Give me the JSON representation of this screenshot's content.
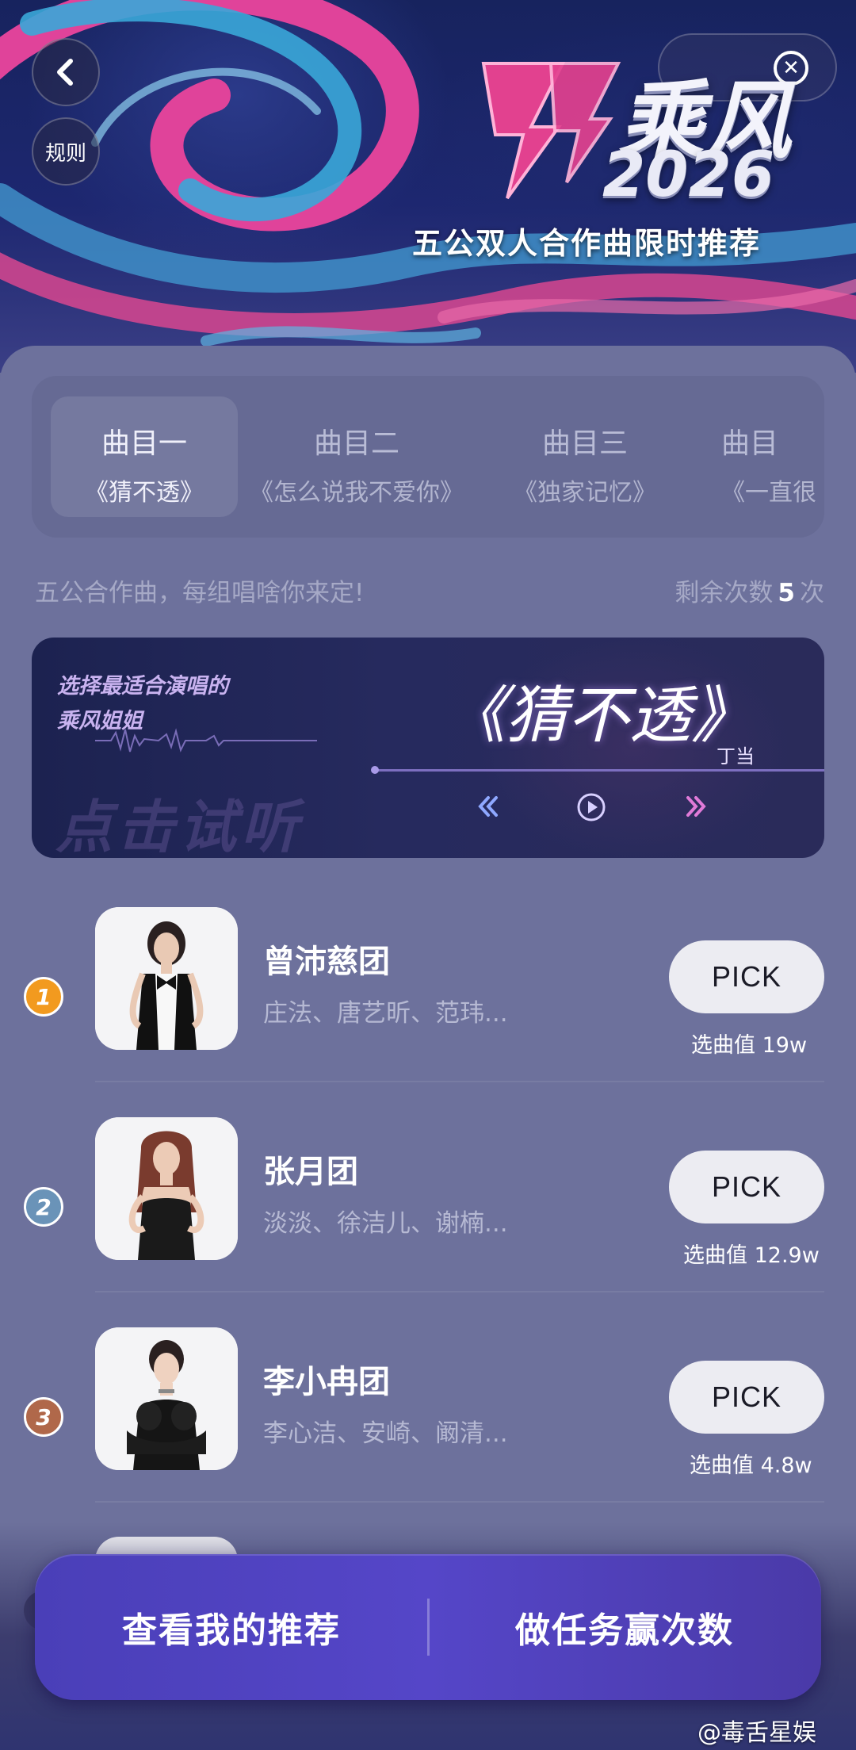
{
  "header": {
    "rules_label": "规则",
    "title": "乘风",
    "year": "2026",
    "subtitle": "五公双人合作曲限时推荐"
  },
  "tabs": [
    {
      "name": "曲目一",
      "song": "《猜不透》",
      "active": true
    },
    {
      "name": "曲目二",
      "song": "《怎么说我不爱你》",
      "active": false
    },
    {
      "name": "曲目三",
      "song": "《独家记忆》",
      "active": false
    },
    {
      "name": "曲目",
      "song": "《一直很",
      "active": false
    }
  ],
  "info": {
    "tagline": "五公合作曲，每组唱啥你来定!",
    "remaining_label": "剩余次数",
    "remaining_count": "5",
    "remaining_unit": "次"
  },
  "banner": {
    "hint_line1": "选择最适合演唱的",
    "hint_line2": "乘风姐姐",
    "song": "《猜不透》",
    "singer": "丁当",
    "bg_text": "点击试听"
  },
  "teams": [
    {
      "rank": "1",
      "name": "曾沛慈团",
      "members": "庄法、唐艺昕、范玮...",
      "pick_label": "PICK",
      "value_label": "选曲值",
      "value": "19w",
      "rank_color": "#f29a1f"
    },
    {
      "rank": "2",
      "name": "张月团",
      "members": "淡淡、徐洁儿、谢楠...",
      "pick_label": "PICK",
      "value_label": "选曲值",
      "value": "12.9w",
      "rank_color": "#6a93b8"
    },
    {
      "rank": "3",
      "name": "李小冉团",
      "members": "李心洁、安崎、阚清...",
      "pick_label": "PICK",
      "value_label": "选曲值",
      "value": "4.8w",
      "rank_color": "#b0684a"
    }
  ],
  "bottom_bar": {
    "left_label": "查看我的推荐",
    "right_label": "做任务赢次数"
  },
  "watermark": "@毒舌星娱"
}
